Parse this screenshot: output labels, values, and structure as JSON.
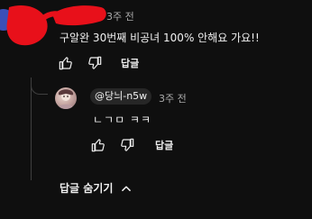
{
  "top_comment": {
    "timestamp": "3주 전",
    "text": "구알완 30번째 비공녀 100% 안해요 가요!!",
    "reply_label": "답글"
  },
  "reply": {
    "author": "@당늬-n5w",
    "timestamp": "3주 전",
    "text": "ㄴㄱㅁ ㅋㅋ",
    "reply_label": "답글"
  },
  "thread": {
    "toggle_label": "답글 숨기기"
  },
  "colors": {
    "background": "#0f0f0f",
    "text": "#f1f1f1",
    "secondary_text": "#aaaaaa",
    "redaction": "#e8101a"
  },
  "icons": {
    "like": "thumbs-up-icon",
    "dislike": "thumbs-down-icon",
    "collapse": "chevron-up-icon"
  }
}
